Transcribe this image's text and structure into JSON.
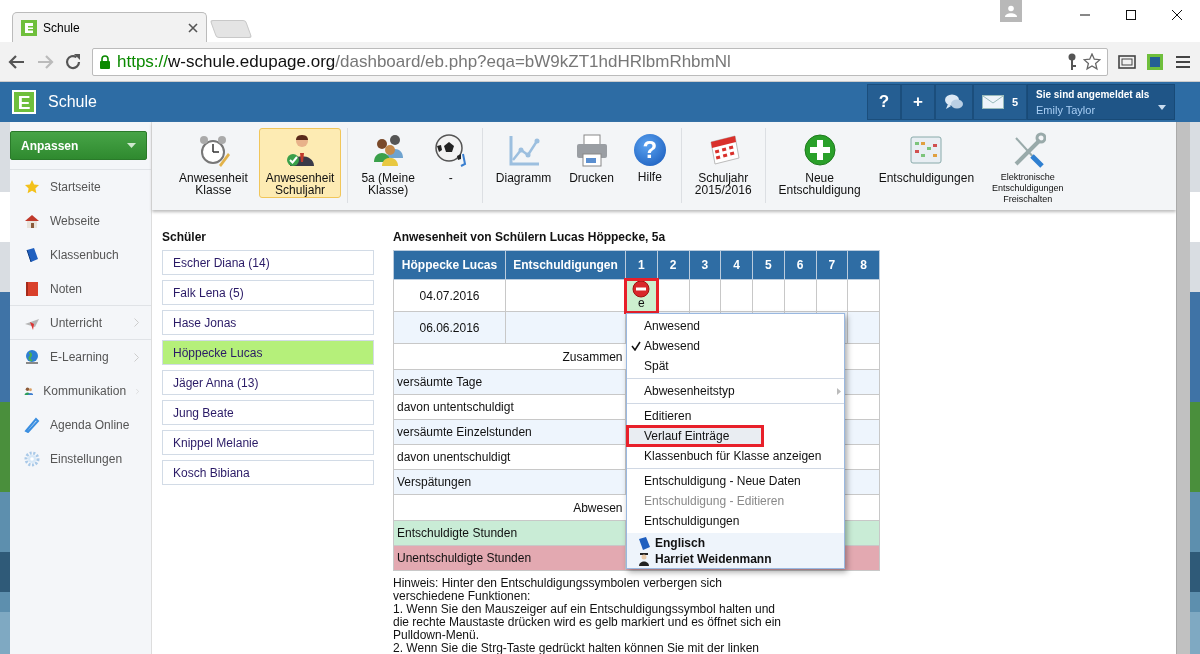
{
  "browser": {
    "tabs": [
      {
        "title": "Schule",
        "selected": true
      }
    ],
    "url_scheme": "https://",
    "url_host": "w-schule.edupage.org",
    "url_path": "/dashboard/eb.php?eqa=bW9kZT1hdHRlbmRhbmNl"
  },
  "app": {
    "logo_letter": "E",
    "title": "Schule",
    "header_buttons": [
      {
        "kind": "text",
        "label": "?"
      },
      {
        "kind": "text",
        "label": "+"
      },
      {
        "kind": "chat"
      },
      {
        "kind": "mail",
        "count": "5"
      }
    ],
    "user": {
      "caption": "Sie sind angemeldet als",
      "name": "Emily Taylor"
    }
  },
  "sidebar": {
    "customize_button": "Anpassen",
    "items": [
      {
        "label": "Startseite",
        "submenu": false,
        "divider_after": false
      },
      {
        "label": "Webseite",
        "submenu": false,
        "divider_after": false
      },
      {
        "label": "Klassenbuch",
        "submenu": false,
        "divider_after": false
      },
      {
        "label": "Noten",
        "submenu": false,
        "divider_after": true
      },
      {
        "label": "Unterricht",
        "submenu": true,
        "divider_after": true
      },
      {
        "label": "E-Learning",
        "submenu": true,
        "divider_after": false
      },
      {
        "label": "Kommunikation",
        "submenu": true,
        "divider_after": false
      },
      {
        "label": "Agenda Online",
        "submenu": false,
        "divider_after": false
      },
      {
        "label": "Einstellungen",
        "submenu": false,
        "divider_after": false
      }
    ]
  },
  "toolbar": {
    "groups": [
      [
        {
          "lines": [
            "Anwesenheit",
            "Klasse"
          ],
          "selected": false
        },
        {
          "lines": [
            "Anwesenheit",
            "Schuljahr"
          ],
          "selected": true
        }
      ],
      [
        {
          "lines": [
            "5a (Meine",
            "Klasse)"
          ],
          "selected": false
        },
        {
          "lines": [
            "-"
          ],
          "selected": false
        }
      ],
      [
        {
          "lines": [
            "Diagramm"
          ],
          "selected": false
        },
        {
          "lines": [
            "Drucken"
          ],
          "selected": false
        },
        {
          "lines": [
            "Hilfe"
          ],
          "selected": false,
          "icon_glyph": "?"
        }
      ],
      [
        {
          "lines": [
            "Schuljahr",
            "2015/2016"
          ],
          "selected": false
        }
      ],
      [
        {
          "lines": [
            "Neue",
            "Entschuldigung"
          ],
          "selected": false
        },
        {
          "lines": [
            "Entschuldigungen"
          ],
          "selected": false
        },
        {
          "lines": [
            "Elektronische",
            "Entschuldigungen",
            "Freischalten"
          ],
          "selected": false,
          "small": true
        }
      ]
    ]
  },
  "students": {
    "heading": "Schüler",
    "items": [
      {
        "label": "Escher Diana (14)",
        "selected": false
      },
      {
        "label": "Falk Lena (5)",
        "selected": false
      },
      {
        "label": "Hase Jonas",
        "selected": false
      },
      {
        "label": "Höppecke Lucas",
        "selected": true
      },
      {
        "label": "Jäger Anna (13)",
        "selected": false
      },
      {
        "label": "Jung Beate",
        "selected": false
      },
      {
        "label": "Knippel Melanie",
        "selected": false
      },
      {
        "label": "Kosch Bibiana",
        "selected": false
      }
    ]
  },
  "attendance": {
    "title": "Anwesenheit von Schülern Lucas Höppecke, 5a",
    "columns": [
      "Höppecke Lucas",
      "Entschuldigungen",
      "1",
      "2",
      "3",
      "4",
      "5",
      "6",
      "7",
      "8"
    ],
    "rows": [
      {
        "date": "04.07.2016",
        "lessons": [
          {
            "kind": "absent",
            "code": "e",
            "highlighted": true
          },
          {
            "kind": "none"
          },
          {
            "kind": "none"
          },
          {
            "kind": "none"
          },
          {
            "kind": "none"
          },
          {
            "kind": "none"
          },
          {
            "kind": "none"
          },
          {
            "kind": "none"
          }
        ]
      },
      {
        "date": "06.06.2016"
      }
    ],
    "summary": [
      {
        "kind": "header",
        "label": "Zusammen"
      },
      {
        "kind": "row",
        "label": "versäumte Tage"
      },
      {
        "kind": "row",
        "label": "davon untentschuldigt"
      },
      {
        "kind": "row",
        "label": "versäumte Einzelstunden"
      },
      {
        "kind": "row",
        "label": "davon unentschuldigt"
      },
      {
        "kind": "row",
        "label": "Verspätungen"
      },
      {
        "kind": "header",
        "label": "Abwesen"
      },
      {
        "kind": "excused",
        "label": "Entschuldigte Stunden"
      },
      {
        "kind": "unexcused",
        "label": "Unentschuldigte Stunden"
      }
    ]
  },
  "context_menu": {
    "sections": [
      [
        {
          "label": "Anwesend",
          "checked": false,
          "disabled": false,
          "submenu": false,
          "hovered": false,
          "highlighted": false
        },
        {
          "label": "Abwesend",
          "checked": true,
          "disabled": false,
          "submenu": false,
          "hovered": false,
          "highlighted": false
        },
        {
          "label": "Spät",
          "checked": false,
          "disabled": false,
          "submenu": false,
          "hovered": false,
          "highlighted": false
        }
      ],
      [
        {
          "label": "Abwesenheitstyp",
          "checked": false,
          "disabled": false,
          "submenu": true,
          "hovered": false,
          "highlighted": false
        }
      ],
      [
        {
          "label": "Editieren",
          "checked": false,
          "disabled": false,
          "submenu": false,
          "hovered": false,
          "highlighted": false
        },
        {
          "label": "Verlauf Einträge",
          "checked": false,
          "disabled": false,
          "submenu": false,
          "hovered": true,
          "highlighted": true
        },
        {
          "label": "Klassenbuch für Klasse anzeigen",
          "checked": false,
          "disabled": false,
          "submenu": false,
          "hovered": false,
          "highlighted": false
        }
      ],
      [
        {
          "label": "Entschuldigung - Neue Daten",
          "checked": false,
          "disabled": false,
          "submenu": false,
          "hovered": false,
          "highlighted": false
        },
        {
          "label": "Entschuldigung - Editieren",
          "checked": false,
          "disabled": true,
          "submenu": false,
          "hovered": false,
          "highlighted": false
        },
        {
          "label": "Entschuldigungen",
          "checked": false,
          "disabled": false,
          "submenu": false,
          "hovered": false,
          "highlighted": false
        }
      ]
    ],
    "footer": {
      "subject": "Englisch",
      "teacher": "Harriet Weidenmann"
    }
  },
  "hint": [
    "Hinweis: Hinter den Entschuldigungssymbolen verbergen sich verschiedene Funktionen:",
    "1. Wenn Sie den Mauszeiger auf ein Entschuldigungssymbol halten und die rechte Maustaste drücken wird es gelb markiert und es öffnet sich ein Pulldown-Menü.",
    "2. Wenn Sie die Strg-Taste gedrückt halten können Sie mit der linken"
  ]
}
